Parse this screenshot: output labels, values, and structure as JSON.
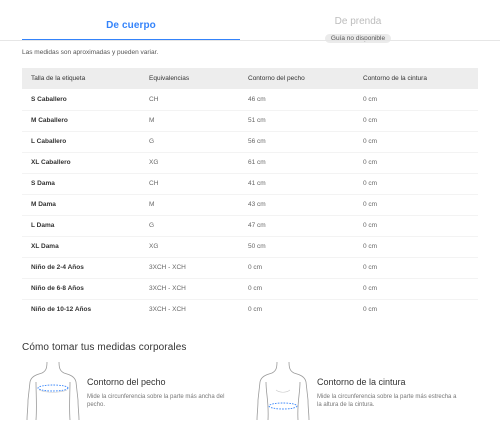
{
  "tabs": {
    "body": {
      "label": "De cuerpo"
    },
    "garment": {
      "label": "De prenda",
      "badge": "Guía no disponible"
    }
  },
  "disclaimer": "Las medidas son aproximadas y pueden variar.",
  "table": {
    "headers": [
      "Talla de la etiqueta",
      "Equivalencias",
      "Contorno del pecho",
      "Contorno de la cintura"
    ],
    "rows": [
      [
        "S Caballero",
        "CH",
        "46 cm",
        "0 cm"
      ],
      [
        "M Caballero",
        "M",
        "51 cm",
        "0 cm"
      ],
      [
        "L Caballero",
        "G",
        "56 cm",
        "0 cm"
      ],
      [
        "XL Caballero",
        "XG",
        "61 cm",
        "0 cm"
      ],
      [
        "S Dama",
        "CH",
        "41 cm",
        "0 cm"
      ],
      [
        "M Dama",
        "M",
        "43 cm",
        "0 cm"
      ],
      [
        "L Dama",
        "G",
        "47 cm",
        "0 cm"
      ],
      [
        "XL Dama",
        "XG",
        "50 cm",
        "0 cm"
      ],
      [
        "Niño de 2-4 Años",
        "3XCH - XCH",
        "0 cm",
        "0 cm"
      ],
      [
        "Niño de 6-8 Años",
        "3XCH - XCH",
        "0 cm",
        "0 cm"
      ],
      [
        "Niño de 10-12 Años",
        "3XCH - XCH",
        "0 cm",
        "0 cm"
      ]
    ]
  },
  "howto": {
    "title": "Cómo tomar tus medidas corporales",
    "chest": {
      "title": "Contorno del pecho",
      "description": "Mide la circunferencia sobre la parte más ancha del pecho."
    },
    "waist": {
      "title": "Contorno de la cintura",
      "description": "Mide la circunferencia sobre la parte más estrecha a la altura de la cintura."
    }
  },
  "colors": {
    "accent": "#3483fa",
    "header_bg": "#ededed",
    "badge_bg": "#ebebeb"
  },
  "icons": {
    "chest": "torso-chest-measure-icon",
    "waist": "torso-waist-measure-icon"
  }
}
